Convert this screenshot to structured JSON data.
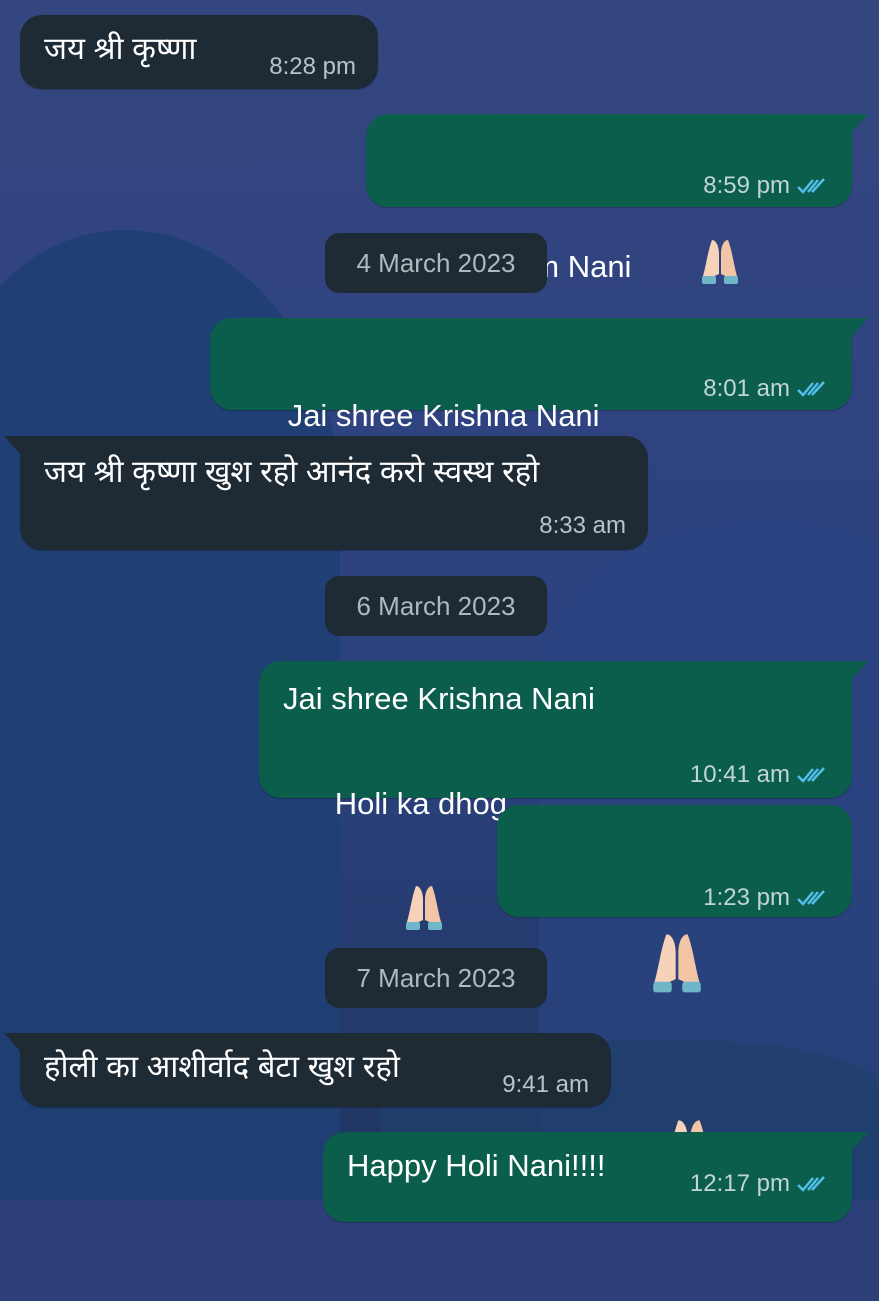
{
  "colors": {
    "incoming_bubble": "#1f2b34",
    "outgoing_bubble": "#0b5e4c",
    "tick_read": "#53bdeb",
    "timestamp_text": "#b8c3c8"
  },
  "messages": [
    {
      "direction": "incoming",
      "text": "जय श्री कृष्णा",
      "time": "8:28 pm"
    },
    {
      "direction": "outgoing",
      "text": "Hari Om Nani",
      "emoji": "folded-hands-icon",
      "time": "8:59 pm",
      "status": "read-double-tick"
    },
    {
      "type": "date",
      "label": "4 March 2023"
    },
    {
      "direction": "outgoing",
      "text": "Jai shree Krishna Nani",
      "emoji": "smiling-face-icon",
      "time": "8:01 am",
      "status": "read-double-tick"
    },
    {
      "direction": "incoming",
      "text": "जय श्री कृष्णा खुश रहो आनंद करो स्वस्थ रहो",
      "time": "8:33 am"
    },
    {
      "type": "date",
      "label": "6 March 2023"
    },
    {
      "direction": "outgoing",
      "text_line1": "Jai shree Krishna Nani",
      "text_line2": "Holi ka dhog",
      "emoji": "folded-hands-icon",
      "time": "10:41 am",
      "status": "read-double-tick"
    },
    {
      "direction": "outgoing",
      "emoji": "folded-hands-icon x2",
      "time": "1:23 pm",
      "status": "read-double-tick"
    },
    {
      "type": "date",
      "label": "7 March 2023"
    },
    {
      "direction": "incoming",
      "text": "होली का आशीर्वाद बेटा खुश रहो",
      "time": "9:41 am"
    },
    {
      "direction": "outgoing",
      "text": "Happy Holi Nani!!!!",
      "time": "12:17 pm",
      "status": "read-double-tick"
    }
  ]
}
